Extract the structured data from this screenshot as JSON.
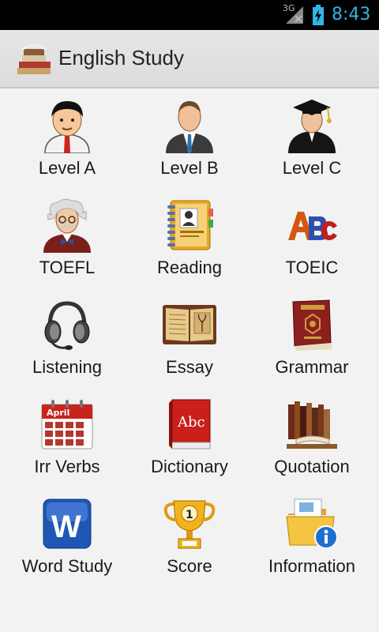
{
  "status_bar": {
    "network": "3G",
    "time": "8:43"
  },
  "app_bar": {
    "title": "English Study",
    "logo_icon": "books-logo-icon"
  },
  "menu": {
    "items": [
      {
        "label": "Level A",
        "icon": "student-boy-icon"
      },
      {
        "label": "Level B",
        "icon": "businessman-icon"
      },
      {
        "label": "Level C",
        "icon": "graduate-icon"
      },
      {
        "label": "TOEFL",
        "icon": "professor-icon"
      },
      {
        "label": "Reading",
        "icon": "address-book-icon"
      },
      {
        "label": "TOEIC",
        "icon": "abc-letters-icon"
      },
      {
        "label": "Listening",
        "icon": "headset-icon"
      },
      {
        "label": "Essay",
        "icon": "open-book-icon"
      },
      {
        "label": "Grammar",
        "icon": "grammar-book-icon"
      },
      {
        "label": "Irr Verbs",
        "icon": "calendar-icon",
        "badge": "April"
      },
      {
        "label": "Dictionary",
        "icon": "dictionary-icon",
        "badge": "Abc"
      },
      {
        "label": "Quotation",
        "icon": "bookshelf-icon"
      },
      {
        "label": "Word Study",
        "icon": "word-w-icon",
        "badge": "W"
      },
      {
        "label": "Score",
        "icon": "trophy-icon",
        "badge": "1"
      },
      {
        "label": "Information",
        "icon": "info-folder-icon"
      }
    ]
  }
}
